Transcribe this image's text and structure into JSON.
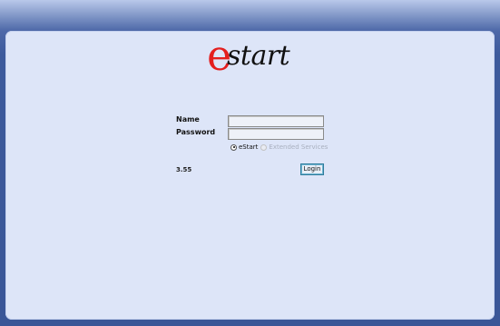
{
  "logo": {
    "letter": "e",
    "text": "start"
  },
  "form": {
    "name_label": "Name",
    "name_value": "",
    "password_label": "Password",
    "password_value": "",
    "options": [
      {
        "label": "eStart",
        "checked": true,
        "disabled": false
      },
      {
        "label": "Extended Services",
        "checked": false,
        "disabled": true
      }
    ],
    "version": "3.55",
    "login_label": "Login"
  },
  "colors": {
    "logo_accent": "#e41f1f",
    "background": "#3d5a9c",
    "panel": "#dde5f8",
    "button_border": "#2f7c9c"
  }
}
